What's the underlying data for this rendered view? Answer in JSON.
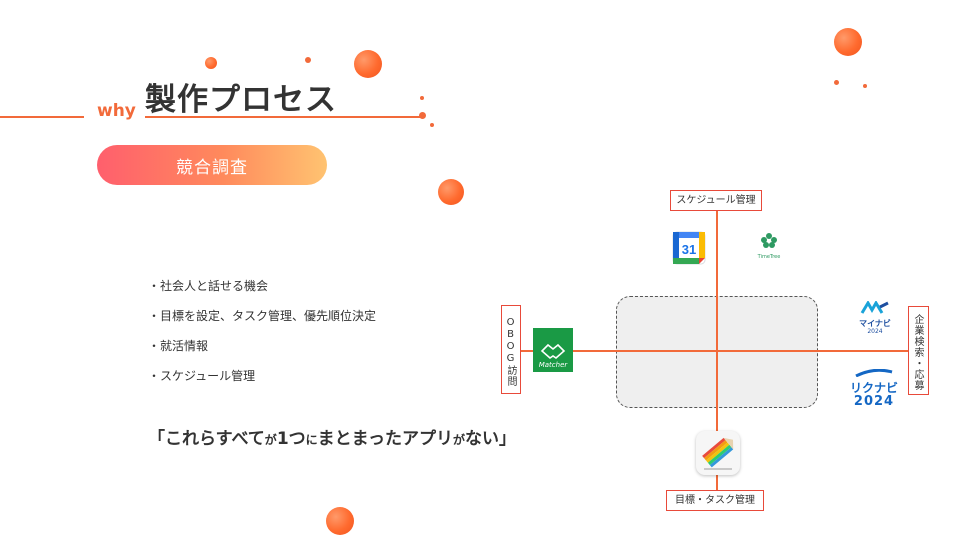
{
  "header": {
    "why": "why",
    "title": "製作プロセス"
  },
  "section_pill": "競合調査",
  "bullets": [
    "・社会人と話せる機会",
    "・目標を設定、タスク管理、優先順位決定",
    "・就活情報",
    "・スケジュール管理"
  ],
  "quote": {
    "open": "「これらすべて",
    "ga1": "が",
    "mid1": "1つ",
    "ni": "に",
    "mid2": "まとまったアプリ",
    "ga2": "が",
    "close": "ない」"
  },
  "diagram": {
    "top_label": "スケジュール管理",
    "bottom_label": "目標・タスク管理",
    "left_label": "OBOG訪問",
    "right_label": "企業検索・応募",
    "apps": {
      "google_calendar": "31",
      "timetree": "TimeTree",
      "matcher": "Matcher",
      "mynavi": "マイナビ",
      "mynavi_year": "2024",
      "rikunabi": "リクナビ",
      "rikunabi_year": "2024"
    }
  },
  "colors": {
    "accent": "#f26a3a",
    "axis": "#f26a3a",
    "label_border": "#e84a3a",
    "pill_start": "#ff5f6d",
    "pill_end": "#ffc371",
    "matcher_green": "#1a9a45",
    "navi_blue": "#1467c4"
  }
}
